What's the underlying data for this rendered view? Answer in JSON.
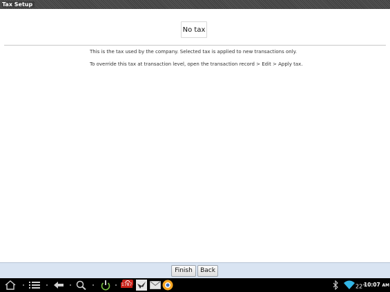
{
  "window": {
    "title": "Tax Setup"
  },
  "tax": {
    "selected_label": "No tax"
  },
  "info": {
    "line1": "This is the tax used by the company. Selected tax is applied to new transactions only.",
    "line2": "To override this tax at transaction level, open the transaction record > Edit > Apply tax."
  },
  "actions": {
    "finish_label": "Finish",
    "back_label": "Back"
  },
  "system_bar": {
    "nav_icons": [
      "home-icon",
      "menu-icon",
      "back-icon",
      "search-icon",
      "power-icon"
    ],
    "notification_icons": [
      "notification-app-icon",
      "bird-app-icon",
      "mail-icon",
      "firefox-icon"
    ],
    "notification_count": "1787",
    "signal_text": "22",
    "signal_sup": "+",
    "time": "10:07",
    "ampm": "AM",
    "status_icons": [
      "bluetooth-icon",
      "wifi-icon"
    ],
    "colors": {
      "wifi": "#33b5e5",
      "notification_badge": "#c8231b",
      "power": "#7ac142",
      "firefox": "#f6a623"
    }
  }
}
